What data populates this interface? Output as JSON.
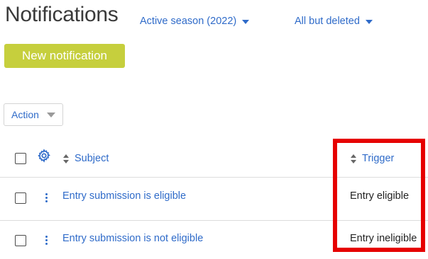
{
  "page": {
    "title": "Notifications"
  },
  "filters": {
    "season_label": "Active season (2022)",
    "status_label": "All but deleted"
  },
  "buttons": {
    "new_notification": "New notification",
    "action": "Action"
  },
  "table": {
    "columns": {
      "subject": "Subject",
      "trigger": "Trigger"
    },
    "rows": [
      {
        "subject": "Entry submission is eligible",
        "trigger": "Entry eligible"
      },
      {
        "subject": "Entry submission is not eligible",
        "trigger": "Entry ineligible"
      }
    ]
  },
  "icons": {
    "settings": "gear-icon",
    "sort": "sort-icon",
    "row_menu": "kebab-menu-icon",
    "dropdown": "caret-down-icon"
  },
  "colors": {
    "link": "#2f6bc9",
    "primary_button": "#c6cf3d",
    "highlight_box": "#e60000"
  }
}
